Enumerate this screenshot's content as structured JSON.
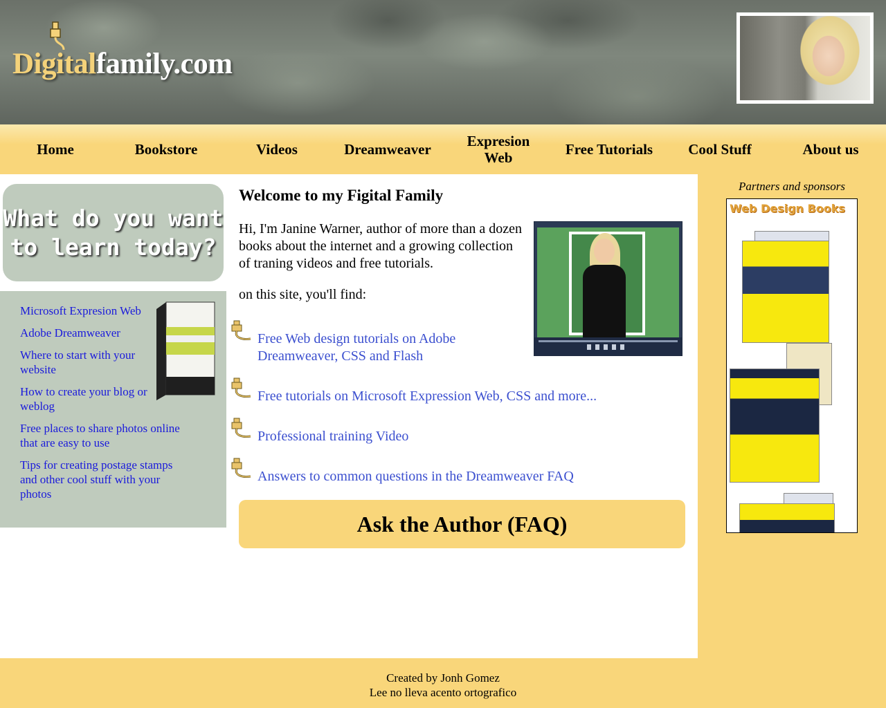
{
  "header": {
    "logo_part1": "Digital",
    "logo_part2": "family.com"
  },
  "nav": {
    "items": [
      {
        "label": "Home"
      },
      {
        "label": "Bookstore"
      },
      {
        "label": "Videos"
      },
      {
        "label": "Dreamweaver"
      },
      {
        "label": "Expresion Web"
      },
      {
        "label": "Free Tutorials"
      },
      {
        "label": "Cool Stuff"
      },
      {
        "label": "About us"
      }
    ]
  },
  "sidebar": {
    "learn_heading": "What do you want to learn today?",
    "links": [
      {
        "label": "Microsoft Expresion Web"
      },
      {
        "label": "Adobe Dreamweaver"
      },
      {
        "label": "Where to start with your website"
      },
      {
        "label": "How to create your blog or weblog"
      },
      {
        "label": "Free places to share photos online that are easy to use"
      },
      {
        "label": "Tips for creating postage stamps and other cool stuff with your photos"
      }
    ]
  },
  "main": {
    "welcome": "Welcome to my Figital Family",
    "intro": "Hi, I'm Janine Warner, author of more than a dozen books about the internet and a growing collection of traning videos and free tutorials.",
    "find": "on this site, you'll find:",
    "bullets": [
      {
        "label": "Free Web design tutorials on Adobe Dreamweaver, CSS and Flash"
      },
      {
        "label": "Free tutorials on Microsoft Expression Web, CSS and more..."
      },
      {
        "label": "Professional training Video"
      },
      {
        "label": "Answers to common questions in the Dreamweaver FAQ"
      }
    ],
    "ask_button": "Ask the Author (FAQ)"
  },
  "right": {
    "partners": "Partners and sponsors",
    "books_title": "Web Design Books"
  },
  "footer": {
    "line1": "Created by Jonh Gomez",
    "line2": "Lee no lleva acento ortografico"
  },
  "colors": {
    "accent_yellow": "#f9d67a",
    "sidebar_green": "#bfcbbd",
    "link_blue": "#3b4fcf"
  }
}
